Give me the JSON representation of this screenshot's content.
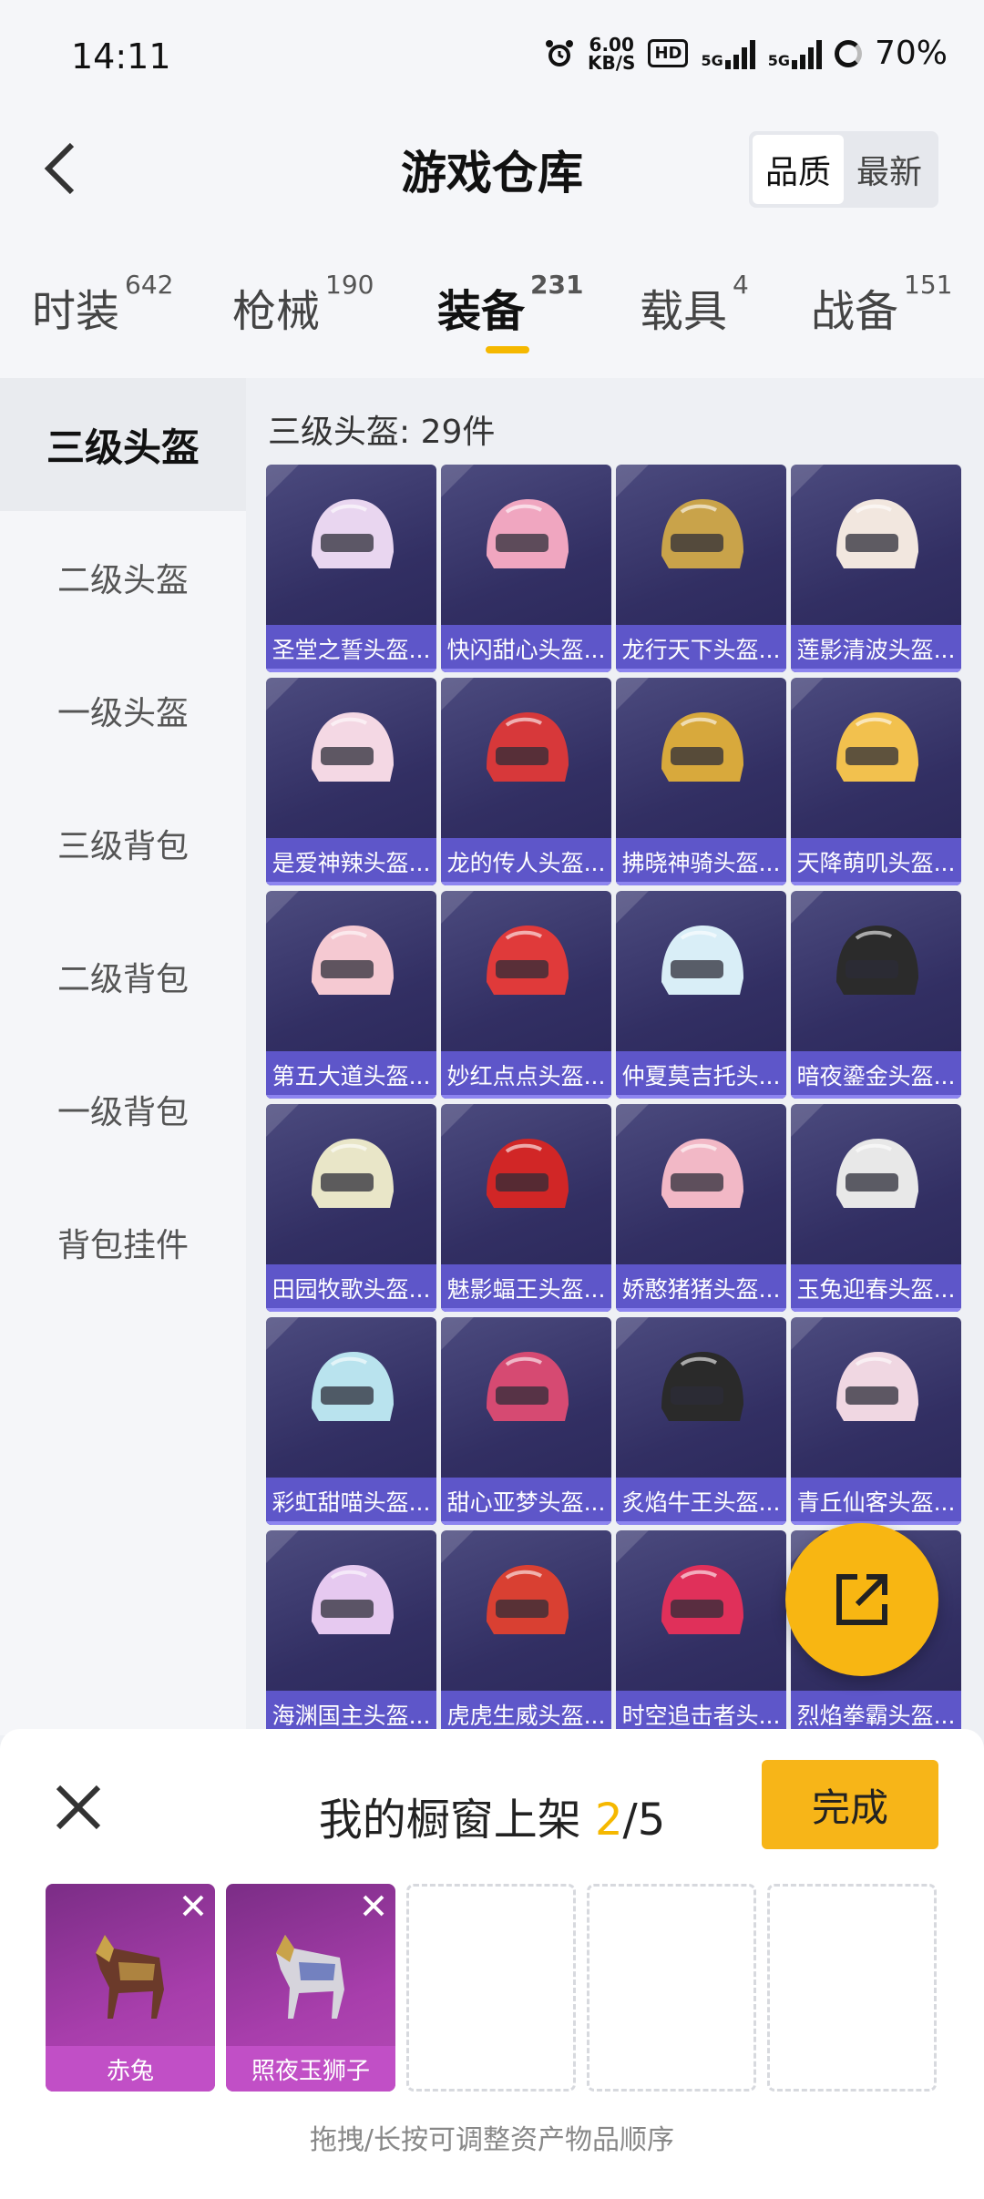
{
  "status_bar": {
    "time": "14:11",
    "speed_value": "6.00",
    "speed_unit": "KB/S",
    "hd": "HD",
    "net1": "5G",
    "net2": "5G",
    "battery": "70%"
  },
  "header": {
    "title": "游戏仓库",
    "sort_quality": "品质",
    "sort_latest": "最新"
  },
  "tabs": [
    {
      "label": "时装",
      "count": "642"
    },
    {
      "label": "枪械",
      "count": "190"
    },
    {
      "label": "装备",
      "count": "231"
    },
    {
      "label": "载具",
      "count": "4"
    },
    {
      "label": "战备",
      "count": "151"
    }
  ],
  "sidebar": {
    "items": [
      "三级头盔",
      "二级头盔",
      "一级头盔",
      "三级背包",
      "二级背包",
      "一级背包",
      "背包挂件"
    ]
  },
  "content": {
    "count_label": "三级头盔: 29件",
    "items": [
      "圣堂之誓头盔...",
      "快闪甜心头盔...",
      "龙行天下头盔...",
      "莲影清波头盔...",
      "是爱神辣头盔...",
      "龙的传人头盔...",
      "拂晓神骑头盔...",
      "天降萌叽头盔...",
      "第五大道头盔...",
      "妙红点点头盔...",
      "仲夏莫吉托头...",
      "暗夜鎏金头盔...",
      "田园牧歌头盔...",
      "魅影蝠王头盔...",
      "娇憨猪猪头盔...",
      "玉兔迎春头盔...",
      "彩虹甜喵头盔...",
      "甜心亚梦头盔...",
      "炙焰牛王头盔...",
      "青丘仙客头盔...",
      "海渊国主头盔...",
      "虎虎生威头盔...",
      "时空追击者头...",
      "烈焰拳霸头盔..."
    ]
  },
  "bottom_sheet": {
    "title_prefix": "我的橱窗上架 ",
    "current": "2",
    "total": "/5",
    "done_label": "完成",
    "slots": [
      "赤兔",
      "照夜玉狮子"
    ],
    "hint": "拖拽/长按可调整资产物品顺序"
  },
  "colors": {
    "accent": "#f5b800",
    "card_label": "#5e56c9",
    "slot_label": "#c14fc6"
  }
}
